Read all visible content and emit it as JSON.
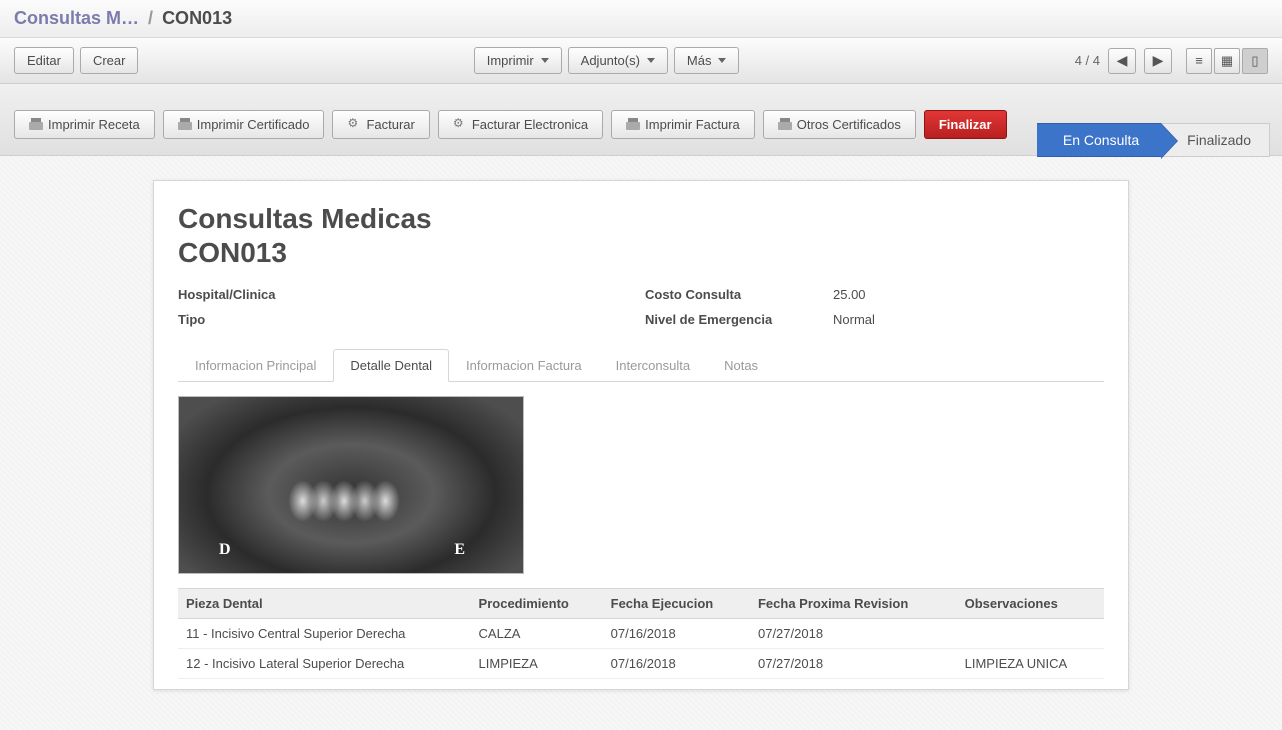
{
  "breadcrumb": {
    "parent": "Consultas M…",
    "current": "CON013"
  },
  "controlbar": {
    "edit": "Editar",
    "create": "Crear",
    "print": "Imprimir",
    "attachments": "Adjunto(s)",
    "more": "Más",
    "pager_text": "4 / 4"
  },
  "actionbar": {
    "print_recipe": "Imprimir Receta",
    "print_certificate": "Imprimir Certificado",
    "invoice": "Facturar",
    "invoice_electronic": "Facturar Electronica",
    "print_invoice": "Imprimir Factura",
    "other_certificates": "Otros Certificados",
    "finalize": "Finalizar"
  },
  "status": {
    "in_consult": "En Consulta",
    "finalized": "Finalizado"
  },
  "sheet": {
    "title": "Consultas Medicas",
    "code": "CON013",
    "labels": {
      "hospital": "Hospital/Clinica",
      "tipo": "Tipo",
      "costo": "Costo Consulta",
      "nivel": "Nivel de Emergencia"
    },
    "values": {
      "hospital": "",
      "tipo": "",
      "costo": "25.00",
      "nivel": "Normal"
    }
  },
  "tabs": {
    "info_principal": "Informacion Principal",
    "detalle_dental": "Detalle Dental",
    "info_factura": "Informacion Factura",
    "interconsulta": "Interconsulta",
    "notas": "Notas"
  },
  "xray": {
    "d": "D",
    "e": "E"
  },
  "table": {
    "headers": {
      "pieza": "Pieza Dental",
      "proc": "Procedimiento",
      "fecha_ejec": "Fecha Ejecucion",
      "fecha_rev": "Fecha Proxima Revision",
      "obs": "Observaciones"
    },
    "rows": [
      {
        "pieza": "11 - Incisivo Central Superior Derecha",
        "proc": "CALZA",
        "fecha_ejec": "07/16/2018",
        "fecha_rev": "07/27/2018",
        "obs": ""
      },
      {
        "pieza": "12 - Incisivo Lateral Superior Derecha",
        "proc": "LIMPIEZA",
        "fecha_ejec": "07/16/2018",
        "fecha_rev": "07/27/2018",
        "obs": "LIMPIEZA UNICA"
      }
    ]
  }
}
